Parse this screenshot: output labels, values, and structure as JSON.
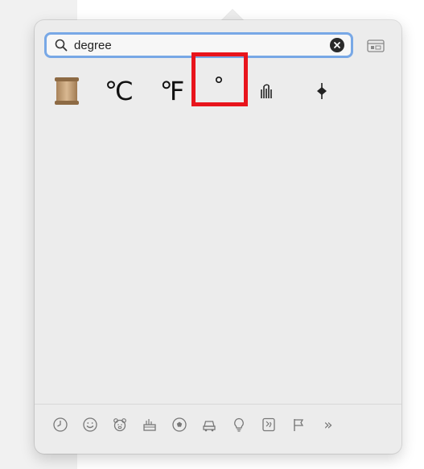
{
  "search": {
    "value": "degree"
  },
  "results": [
    {
      "name": "scroll",
      "glyph": ""
    },
    {
      "name": "degree-celsius",
      "glyph": "℃"
    },
    {
      "name": "degree-fahrenheit",
      "glyph": "℉"
    },
    {
      "name": "degree-sign",
      "glyph": "°"
    },
    {
      "name": "alembic",
      "glyph": ""
    },
    {
      "name": "aries",
      "glyph": ""
    }
  ],
  "highlight_color": "#e8141c",
  "search_focus_color": "#78a8e6",
  "categories": [
    {
      "icon": "clock-icon"
    },
    {
      "icon": "smiley-icon"
    },
    {
      "icon": "animal-icon"
    },
    {
      "icon": "food-icon"
    },
    {
      "icon": "soccer-ball-icon"
    },
    {
      "icon": "car-icon"
    },
    {
      "icon": "lightbulb-icon"
    },
    {
      "icon": "symbols-icon"
    },
    {
      "icon": "flag-icon"
    }
  ],
  "more_label": "»"
}
